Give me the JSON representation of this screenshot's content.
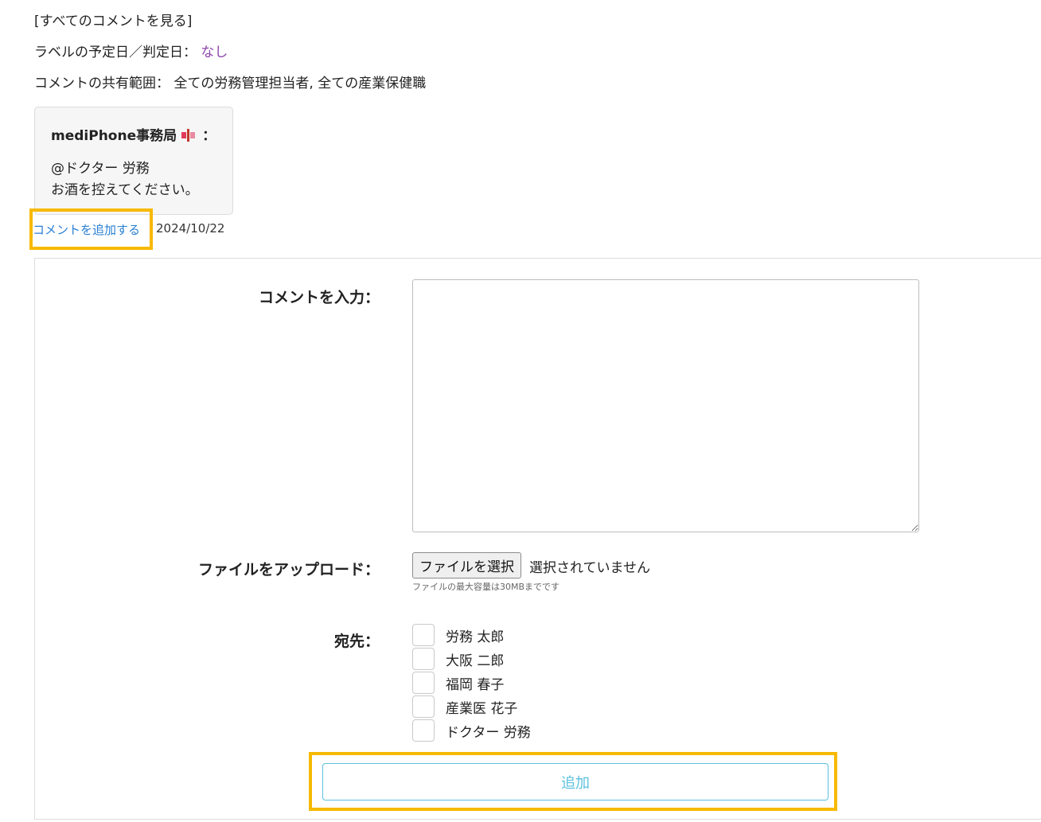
{
  "links": {
    "all_comments": "[すべてのコメントを見る]",
    "add_comment": "コメントを追加する"
  },
  "label_date": {
    "label": "ラベルの予定日／判定日：",
    "value": "なし"
  },
  "share_scope": {
    "label": "コメントの共有範囲：",
    "value": "全ての労務管理担当者, 全ての産業保健職"
  },
  "comment": {
    "author": "mediPhone事務局",
    "author_icon": "flag-icon",
    "separator": "：",
    "mention": "@ドクター 労務",
    "text": "お酒を控えてください。",
    "date": "2024/10/22"
  },
  "form": {
    "comment_label": "コメントを入力：",
    "comment_value": "",
    "file_label": "ファイルをアップロード：",
    "file_button": "ファイルを選択",
    "file_status": "選択されていません",
    "file_note": "ファイルの最大容量は30MBまでです",
    "recipients_label": "宛先：",
    "recipients": [
      {
        "name": "労務 太郎",
        "checked": false
      },
      {
        "name": "大阪 二郎",
        "checked": false
      },
      {
        "name": "福岡 春子",
        "checked": false
      },
      {
        "name": "産業医 花子",
        "checked": false
      },
      {
        "name": "ドクター 労務",
        "checked": false
      }
    ],
    "submit_label": "追加"
  },
  "colors": {
    "link": "#2a7fd4",
    "accent_purple": "#8e44ad",
    "highlight": "#f7b900",
    "button_border": "#5bc0de"
  }
}
